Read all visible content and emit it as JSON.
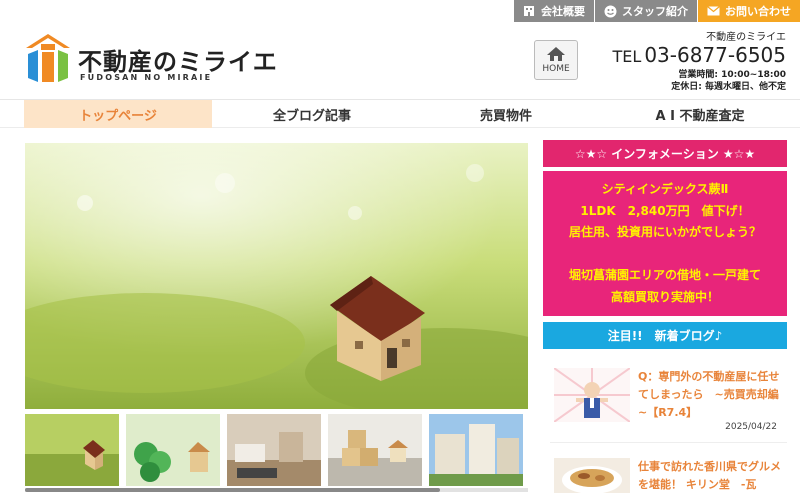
{
  "util": {
    "company_label": "会社概要",
    "staff_label": "スタッフ紹介",
    "contact_label": "お問い合わせ"
  },
  "logo": {
    "jp": "不動産のミライエ",
    "en": "FUDOSAN NO MIRAIE"
  },
  "home_button": {
    "label": "HOME"
  },
  "contact": {
    "company": "不動産のミライエ",
    "tel_label": "TEL",
    "tel": "03-6877-6505",
    "hours": "営業時間: 10:00~18:00",
    "closed": "定休日: 毎週水曜日、他不定"
  },
  "nav": {
    "items": [
      {
        "label": "トップページ"
      },
      {
        "label": "全ブログ記事"
      },
      {
        "label": "売買物件"
      },
      {
        "label": "A I 不動産査定"
      }
    ]
  },
  "info": {
    "heading": "☆★☆ インフォメーション ★☆★",
    "lines": [
      "シティインデックス蕨Ⅱ",
      "1LDK　2,840万円　値下げ！",
      "居住用、投資用にいかがでしょう？",
      "",
      "堀切菖蒲園エリアの借地・一戸建て",
      "高額買取り実施中！"
    ]
  },
  "blog": {
    "heading": "注目!!　新着ブログ♪",
    "posts": [
      {
        "title": "Q：専門外の不動産屋に任せてしまったら　~売買売却編~【R7.4】",
        "date": "2025/04/22"
      },
      {
        "title": "仕事で訪れた香川県でグルメを堪能！ キリン堂　-瓦",
        "date": ""
      }
    ]
  },
  "colors": {
    "accent_orange": "#e8843a",
    "info_pink": "#e8257a",
    "blog_blue": "#1aa8e0",
    "util_gray": "#8a8a8a",
    "util_orange": "#f5a623"
  }
}
